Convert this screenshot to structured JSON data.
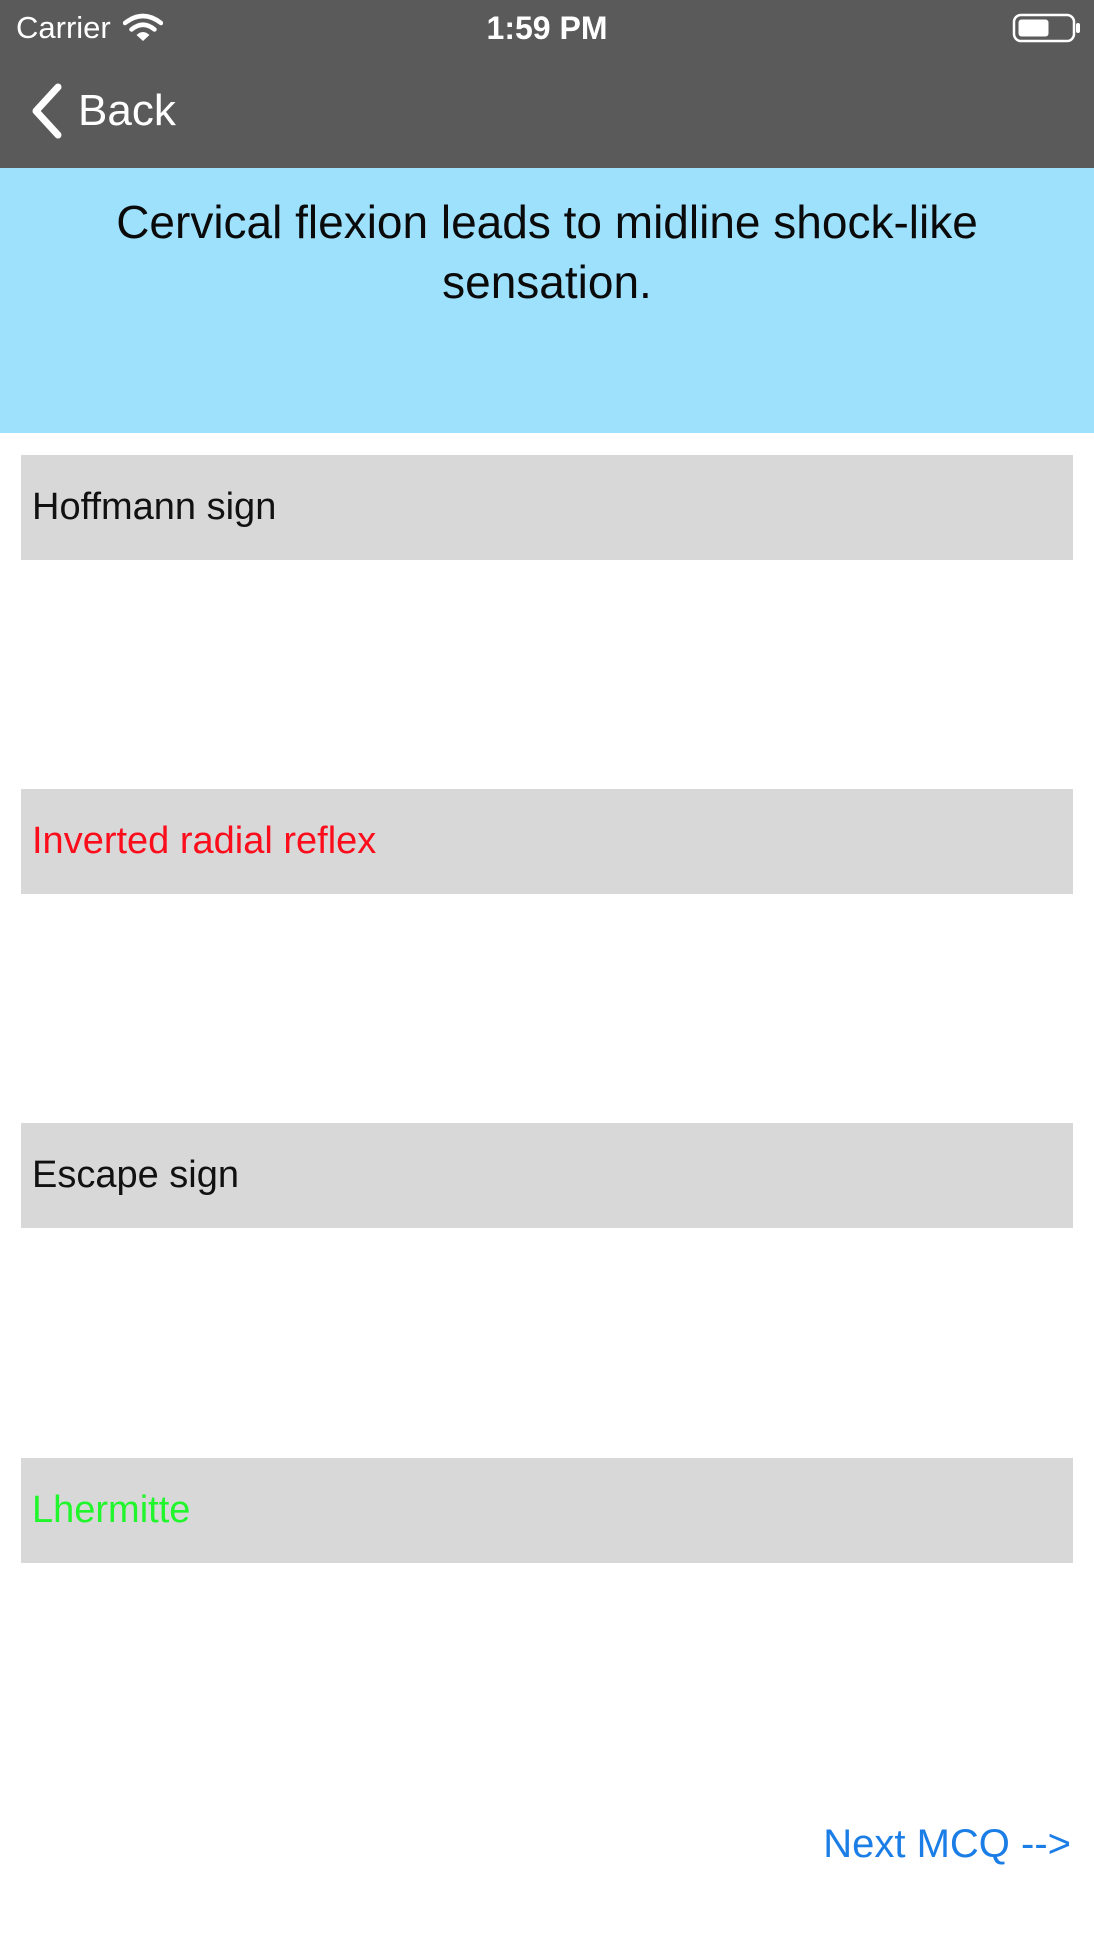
{
  "status_bar": {
    "carrier": "Carrier",
    "time": "1:59 PM",
    "wifi_icon": "wifi-icon",
    "battery_icon": "battery-icon"
  },
  "nav": {
    "back_label": "Back",
    "back_icon": "chevron-left-icon"
  },
  "question": {
    "text": "Cervical flexion leads to midline shock-like sensation."
  },
  "options": [
    {
      "label": "Hoffmann sign",
      "color": "#111111",
      "state": "neutral"
    },
    {
      "label": "Inverted radial reflex",
      "color": "#fc0d1b",
      "state": "incorrect"
    },
    {
      "label": "Escape sign",
      "color": "#111111",
      "state": "neutral"
    },
    {
      "label": "Lhermitte",
      "color": "#21f52b",
      "state": "correct"
    }
  ],
  "footer": {
    "next_label": "Next MCQ -->"
  },
  "colors": {
    "nav_background": "#5a5a5a",
    "question_background": "#9ee1fc",
    "option_background": "#d8d8d8",
    "link_blue": "#1b7ee6"
  }
}
